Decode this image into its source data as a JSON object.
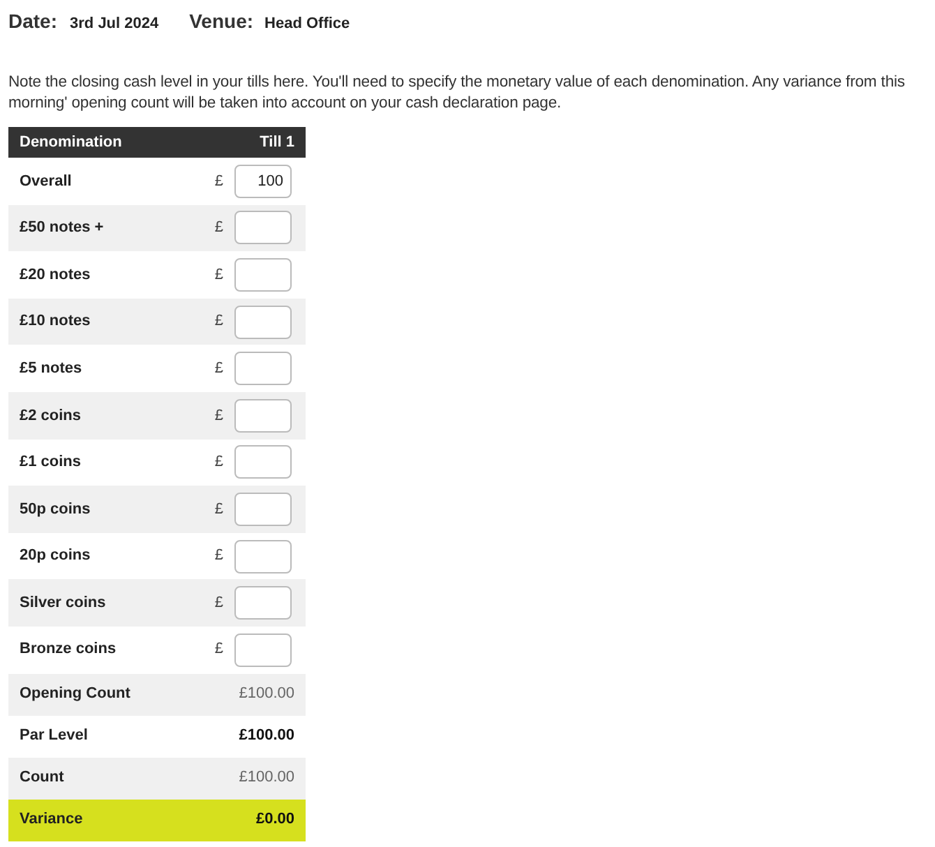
{
  "header": {
    "date_label": "Date:",
    "date": "3rd Jul 2024",
    "venue_label": "Venue:",
    "venue": "Head Office"
  },
  "instructions": "Note the closing cash level in your tills here. You'll need to specify the monetary value of each denomination. Any variance from this morning' opening count will be taken into account on your cash declaration page.",
  "table": {
    "columns": [
      "Denomination",
      "Till 1"
    ],
    "rows": [
      {
        "kind": "input",
        "label": "Overall",
        "currency": "£",
        "value": "100"
      },
      {
        "kind": "input",
        "label": "£50 notes +",
        "currency": "£"
      },
      {
        "kind": "input",
        "label": "£20 notes",
        "currency": "£"
      },
      {
        "kind": "input",
        "label": "£10 notes",
        "currency": "£"
      },
      {
        "kind": "input",
        "label": "£5 notes",
        "currency": "£"
      },
      {
        "kind": "input",
        "label": "£2 coins",
        "currency": "£"
      },
      {
        "kind": "input",
        "label": "£1 coins",
        "currency": "£"
      },
      {
        "kind": "input",
        "label": "50p coins",
        "currency": "£"
      },
      {
        "kind": "input",
        "label": "20p coins",
        "currency": "£"
      },
      {
        "kind": "input",
        "label": "Silver coins",
        "currency": "£"
      },
      {
        "kind": "input",
        "label": "Bronze coins",
        "currency": "£"
      },
      {
        "kind": "total",
        "label": "Opening Count",
        "value": "£100.00",
        "bold": false,
        "highlight": false
      },
      {
        "kind": "total",
        "label": "Par Level",
        "value": "£100.00",
        "bold": true,
        "highlight": false
      },
      {
        "kind": "total",
        "label": "Count",
        "value": "£100.00",
        "bold": false,
        "highlight": false
      },
      {
        "kind": "total",
        "label": "Variance",
        "value": "£0.00",
        "bold": true,
        "highlight": true
      }
    ]
  }
}
